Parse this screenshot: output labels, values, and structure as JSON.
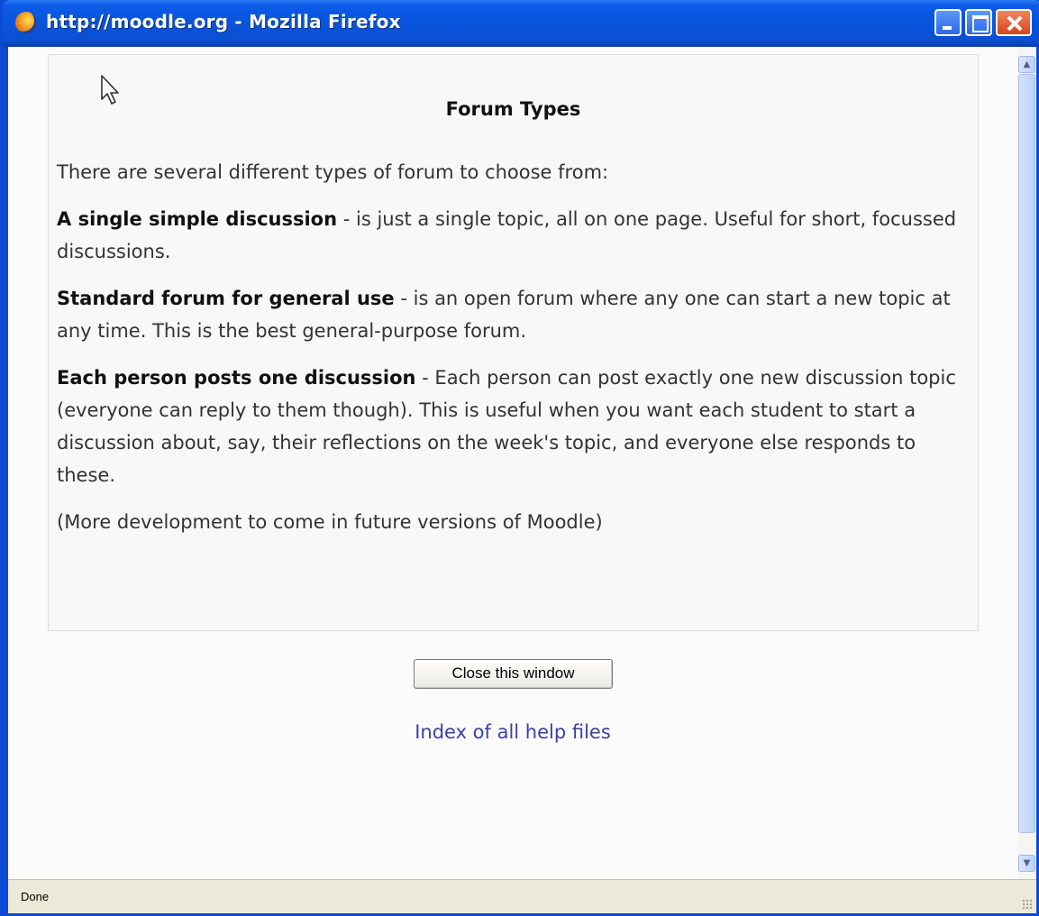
{
  "window": {
    "title": "http://moodle.org - Mozilla Firefox"
  },
  "help": {
    "title": "Forum Types",
    "intro": "There are several different types of forum to choose from:",
    "types": [
      {
        "name": "A single simple discussion",
        "description": " - is just a single topic, all on one page. Useful for short, focussed discussions."
      },
      {
        "name": "Standard forum for general use",
        "description": " - is an open forum where any one can start a new topic at any time. This is the best general-purpose forum."
      },
      {
        "name": "Each person posts one discussion",
        "description": " - Each person can post exactly one new discussion topic (everyone can reply to them though). This is useful when you want each student to start a discussion about, say, their reflections on the week's topic, and everyone else responds to these."
      }
    ],
    "note": "(More development to come in future versions of Moodle)"
  },
  "actions": {
    "close_label": "Close this window",
    "index_link": "Index of all help files"
  },
  "status": {
    "text": "Done"
  },
  "icons": {
    "browser": "firefox-icon",
    "minimize": "minimize-icon",
    "maximize": "maximize-icon",
    "close": "close-icon",
    "cursor": "mouse-pointer-icon"
  }
}
